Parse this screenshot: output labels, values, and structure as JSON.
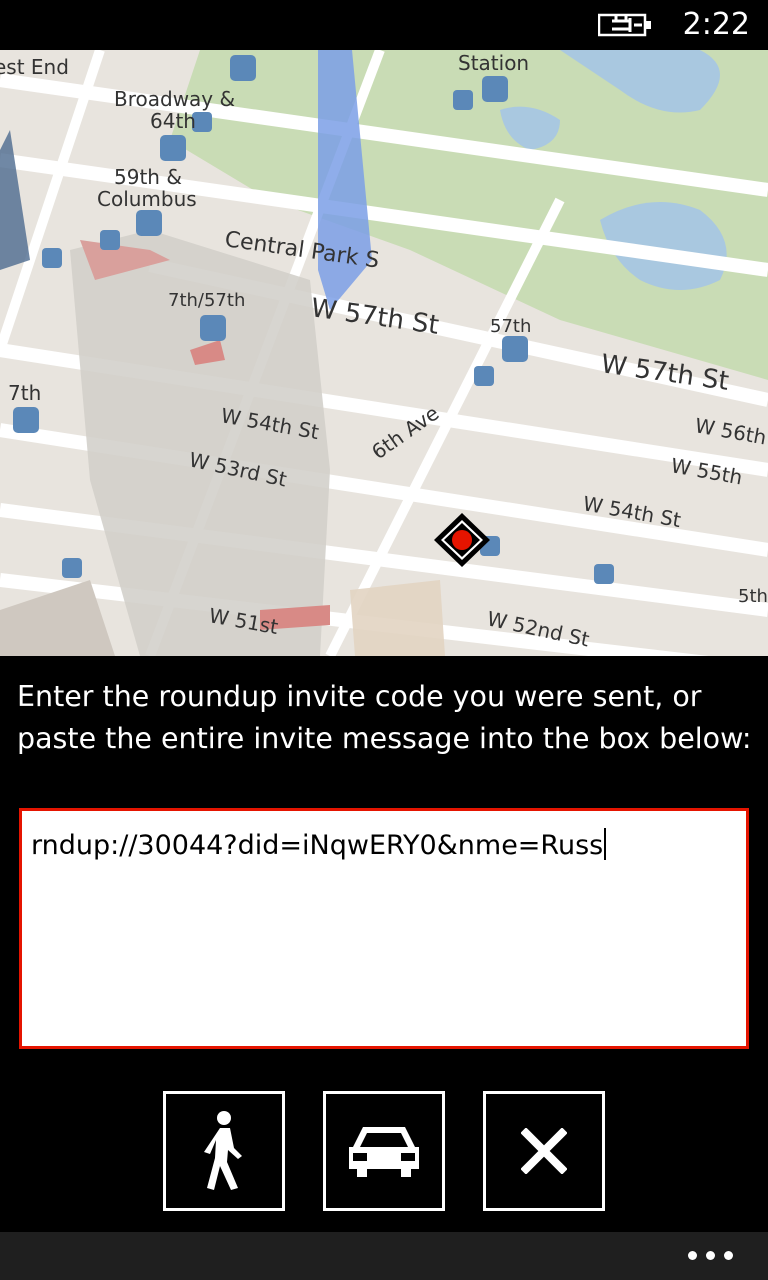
{
  "status_bar": {
    "time": "2:22",
    "battery_icon": "battery-charging-icon"
  },
  "map": {
    "labels": {
      "west_end": "est End",
      "station": "Station",
      "broadway_line1": "Broadway &",
      "broadway_line2": "64th",
      "columbus_line1": "59th &",
      "columbus_line2": "Columbus",
      "central_park_s": "Central Park S",
      "w57_a": "W 57th St",
      "w57_b": "W 57th St",
      "seventh_57th": "7th/57th",
      "fifty_seventh": "57th",
      "seventh": "7th",
      "w54_a": "W 54th St",
      "sixth_ave": "6th Ave",
      "w56": "W 56th",
      "w53": "W 53rd St",
      "w55": "W 55th",
      "w54_b": "W 54th St",
      "fifth": "5th",
      "w51": "W 51st",
      "w52": "W 52nd St"
    },
    "location_marker": "location-pin-icon"
  },
  "prompt": {
    "text": "Enter the roundup invite code you were sent, or paste the entire invite message into the box below:"
  },
  "invite_input": {
    "value": "rndup://30044?did=iNqwERY0&nme=Russ"
  },
  "actions": [
    {
      "icon": "walk-icon"
    },
    {
      "icon": "car-icon"
    },
    {
      "icon": "close-icon"
    }
  ],
  "app_bar": {
    "more_icon": "more-icon"
  },
  "colors": {
    "accent": "#e51400",
    "background": "#000000",
    "foreground": "#ffffff",
    "app_bar": "#1f1f1f"
  }
}
